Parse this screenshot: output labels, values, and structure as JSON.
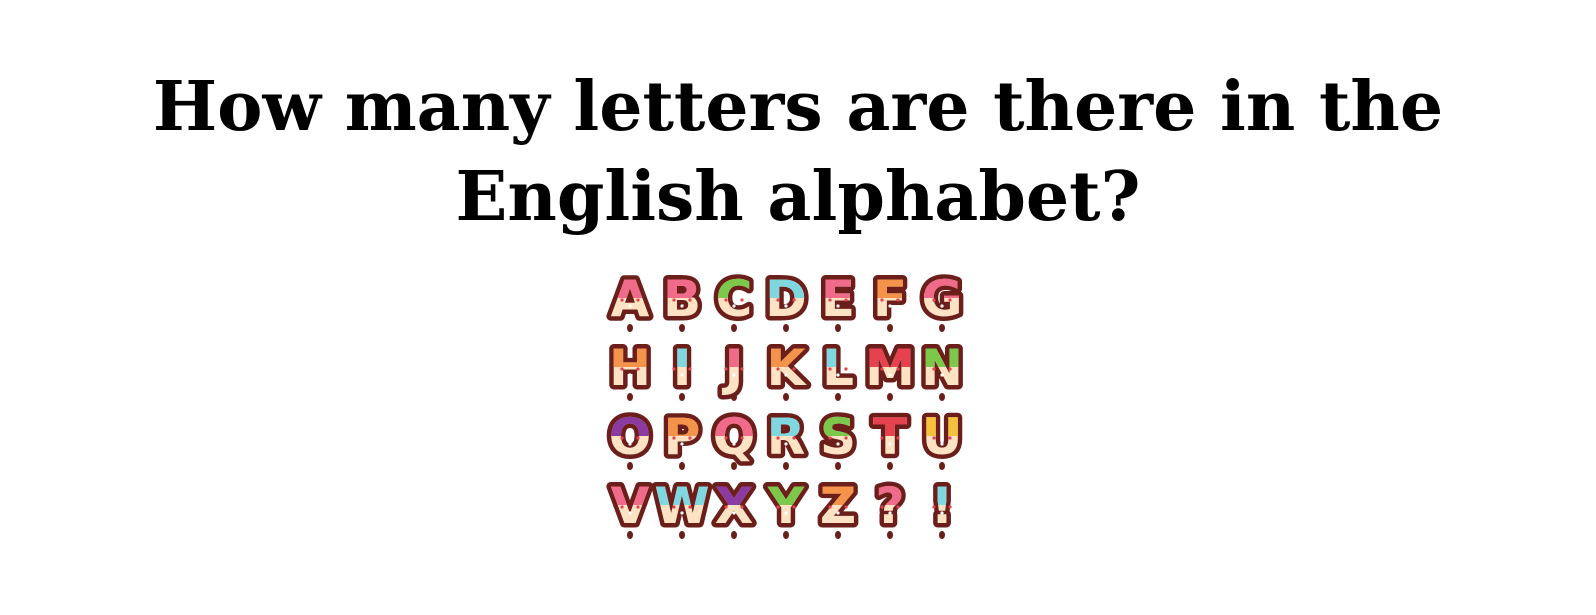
{
  "question": {
    "line1": "How many letters are there in the",
    "line2": "English alphabet?"
  },
  "alphabet_art": {
    "rows": [
      [
        "A",
        "B",
        "C",
        "D",
        "E",
        "F",
        "G"
      ],
      [
        "H",
        "I",
        "J",
        "K",
        "L",
        "M",
        "N"
      ],
      [
        "O",
        "P",
        "Q",
        "R",
        "S",
        "T",
        "U"
      ],
      [
        "V",
        "W",
        "X",
        "Y",
        "Z",
        "?",
        "!"
      ]
    ],
    "colors": {
      "outline": "#6b1e1a",
      "dough": "#fde3c4",
      "pink": "#f06a8a",
      "cyan": "#7fd8e0",
      "green": "#7cc84a",
      "orange": "#f3944a",
      "purple": "#8a3aa0",
      "yellow": "#f4c23a",
      "red": "#e5414f"
    },
    "letter_colors": [
      [
        "pink",
        "pink",
        "green",
        "cyan",
        "pink",
        "orange",
        "pink"
      ],
      [
        "orange",
        "cyan",
        "pink",
        "orange",
        "cyan",
        "red",
        "green"
      ],
      [
        "purple",
        "orange",
        "pink",
        "cyan",
        "green",
        "red",
        "yellow"
      ],
      [
        "pink",
        "cyan",
        "purple",
        "green",
        "orange",
        "pink",
        "cyan"
      ]
    ]
  }
}
